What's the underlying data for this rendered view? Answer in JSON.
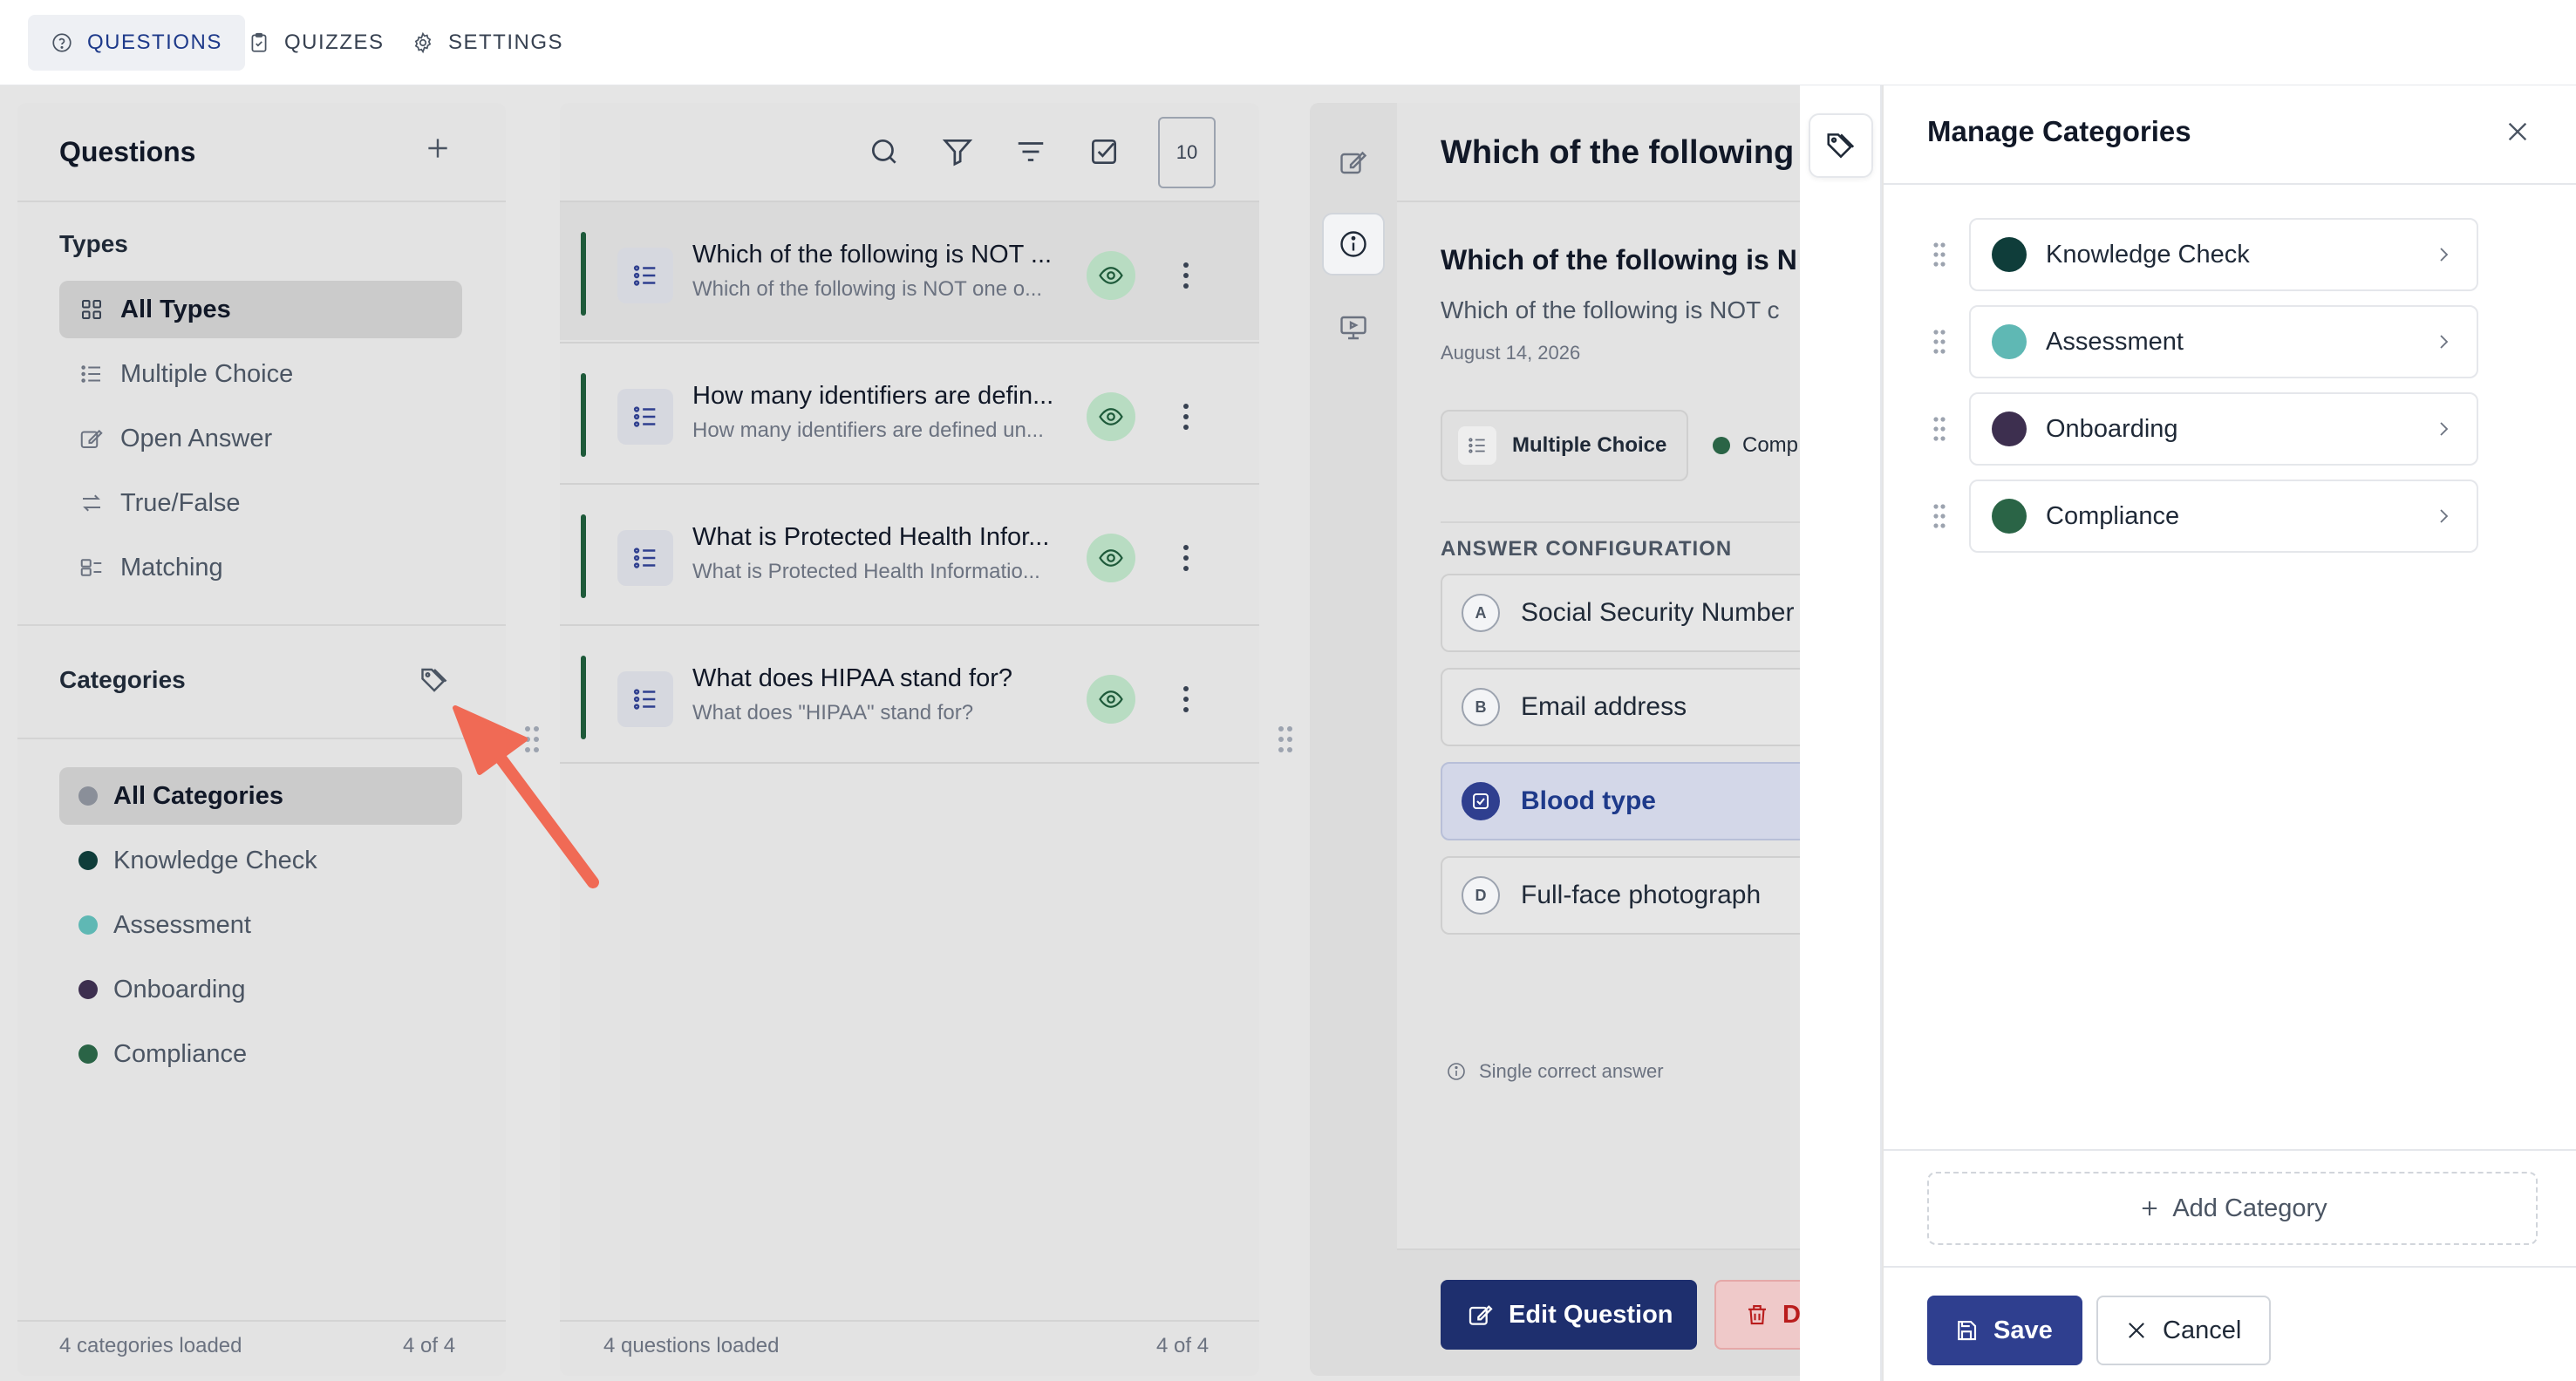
{
  "topnav": {
    "tabs": [
      {
        "label": "QUESTIONS",
        "icon": "question-circle-icon",
        "active": true
      },
      {
        "label": "QUIZZES",
        "icon": "clipboard-icon",
        "active": false
      },
      {
        "label": "SETTINGS",
        "icon": "gear-icon",
        "active": false
      }
    ]
  },
  "left": {
    "title": "Questions",
    "types_title": "Types",
    "types": [
      {
        "label": "All Types",
        "icon": "grid-icon",
        "active": true
      },
      {
        "label": "Multiple Choice",
        "icon": "list-icon",
        "active": false
      },
      {
        "label": "Open Answer",
        "icon": "edit-icon",
        "active": false
      },
      {
        "label": "True/False",
        "icon": "swap-icon",
        "active": false
      },
      {
        "label": "Matching",
        "icon": "matching-icon",
        "active": false
      }
    ],
    "categories_title": "Categories",
    "categories": [
      {
        "label": "All Categories",
        "color": "#8a8f99",
        "active": true
      },
      {
        "label": "Knowledge Check",
        "color": "#0f3d3a",
        "active": false
      },
      {
        "label": "Assessment",
        "color": "#5fb8b4",
        "active": false
      },
      {
        "label": "Onboarding",
        "color": "#3d2f4f",
        "active": false
      },
      {
        "label": "Compliance",
        "color": "#2a6446",
        "active": false
      }
    ],
    "footer_left": "4 categories loaded",
    "footer_right": "4 of 4"
  },
  "middle": {
    "count_badge": "10",
    "questions": [
      {
        "title": "Which of the following is NOT ...",
        "subtitle": "Which of the following is NOT one o..."
      },
      {
        "title": "How many identifiers are defin...",
        "subtitle": "How many identifiers are defined un..."
      },
      {
        "title": "What is Protected Health Infor...",
        "subtitle": "What is Protected Health Informatio..."
      },
      {
        "title": "What does HIPAA stand for?",
        "subtitle": "What does \"HIPAA\" stand for?"
      }
    ],
    "footer_left": "4 questions loaded",
    "footer_right": "4 of 4"
  },
  "detail": {
    "header": "Which of the following i",
    "question_title": "Which of the following is N",
    "question_text": "Which of the following is NOT c",
    "date": "August 14, 2026",
    "type_chip": "Multiple Choice",
    "category_chip": "Comp",
    "category_color": "#2a6446",
    "section": "ANSWER CONFIGURATION",
    "answers": [
      {
        "letter": "A",
        "text": "Social Security Number",
        "correct": false
      },
      {
        "letter": "B",
        "text": "Email address",
        "correct": false
      },
      {
        "letter": "C",
        "text": "Blood type",
        "correct": true
      },
      {
        "letter": "D",
        "text": "Full-face photograph",
        "correct": false
      }
    ],
    "hint": "Single correct answer",
    "edit_label": "Edit Question",
    "delete_label": "D"
  },
  "drawer": {
    "title": "Manage Categories",
    "categories": [
      {
        "label": "Knowledge Check",
        "color": "#0f3d3a"
      },
      {
        "label": "Assessment",
        "color": "#5fb8b4"
      },
      {
        "label": "Onboarding",
        "color": "#3d2f4f"
      },
      {
        "label": "Compliance",
        "color": "#2a6446"
      }
    ],
    "add_label": "Add Category",
    "save_label": "Save",
    "cancel_label": "Cancel"
  },
  "colors": {
    "primary": "#2f3f8f",
    "primary_dark": "#1e2f6e",
    "accent_green": "#1e5a3a",
    "arrow": "#f06a55"
  }
}
